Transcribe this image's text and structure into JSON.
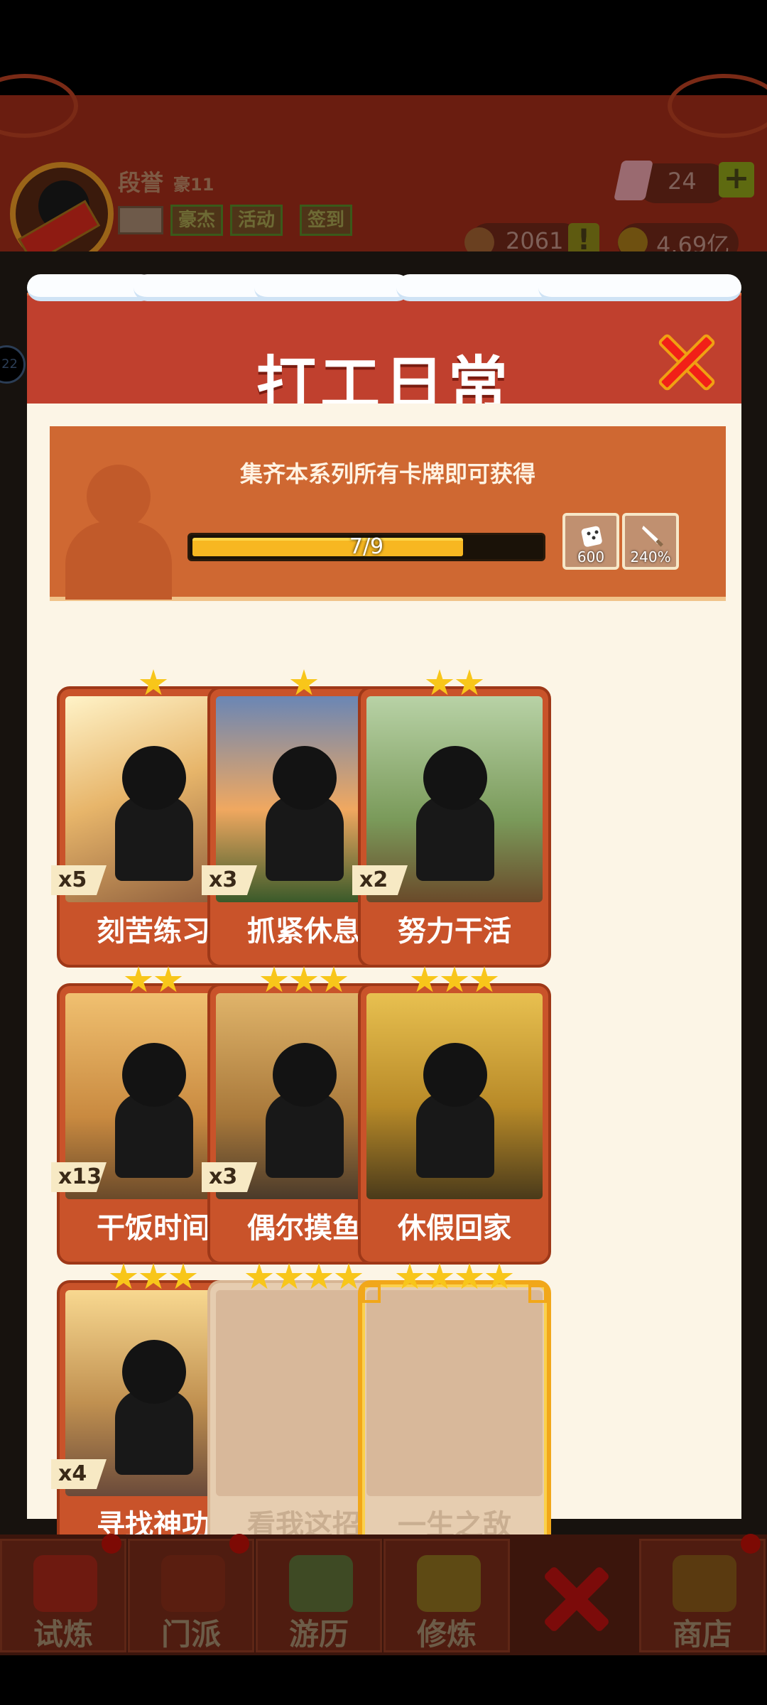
{
  "hud": {
    "player_name": "段誉",
    "player_rank": "豪11",
    "tags": [
      "豪杰",
      "活动",
      "签到"
    ],
    "gems": "24",
    "plus": "+",
    "resource1": "2061",
    "warn": "!",
    "gold": "4.69亿",
    "side_badge": "22"
  },
  "modal": {
    "title": "打工日常",
    "banner_text": "集齐本系列所有卡牌即可获得",
    "progress_text": "7/9",
    "progress_fraction": 0.778,
    "rewards": [
      {
        "icon": "dice-icon",
        "label": "600"
      },
      {
        "icon": "sword-icon",
        "label": "240%"
      }
    ]
  },
  "cards": [
    {
      "name": "刻苦练习",
      "qty": "x5",
      "stars": 1
    },
    {
      "name": "抓紧休息",
      "qty": "x3",
      "stars": 1
    },
    {
      "name": "努力干活",
      "qty": "x2",
      "stars": 2
    },
    {
      "name": "干饭时间",
      "qty": "x13",
      "stars": 2
    },
    {
      "name": "偶尔摸鱼",
      "qty": "x3",
      "stars": 3
    },
    {
      "name": "休假回家",
      "qty": "",
      "stars": 3
    },
    {
      "name": "寻找神功",
      "qty": "x4",
      "stars": 3
    },
    {
      "name": "看我这招",
      "qty": "",
      "stars": 4,
      "locked": true
    },
    {
      "name": "一生之敌",
      "qty": "",
      "stars": 4,
      "locked": true
    }
  ],
  "nav": {
    "items": [
      "试炼",
      "门派",
      "游历",
      "修炼",
      "商店"
    ]
  },
  "colors": {
    "header_red": "#c0402e",
    "card_orange": "#c9532a",
    "progress_yellow": "#f7b721",
    "star_gold": "#f8c61a"
  }
}
